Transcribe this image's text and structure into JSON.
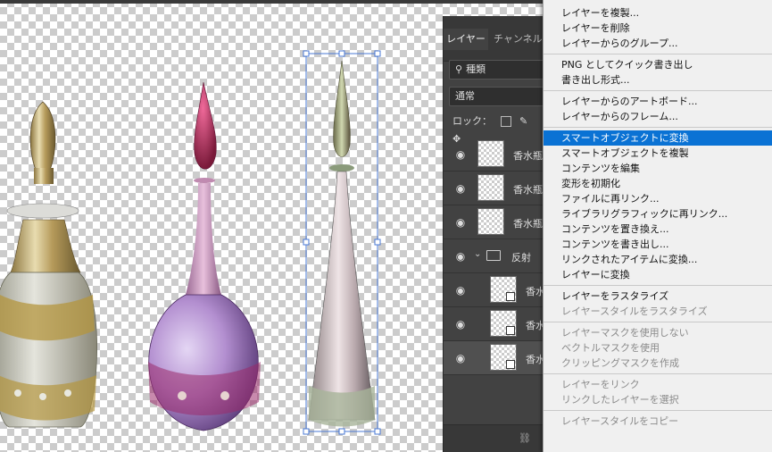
{
  "layers_panel": {
    "tabs": [
      {
        "label": "レイヤー",
        "active": true
      },
      {
        "label": "チャンネル",
        "active": false
      }
    ],
    "search_value": "種類",
    "blend_mode": "通常",
    "lock_label": "ロック：",
    "layers": [
      {
        "name": "香水瓶",
        "type": "smart-object",
        "indent": false
      },
      {
        "name": "香水瓶",
        "type": "smart-object",
        "indent": false
      },
      {
        "name": "香水瓶",
        "type": "smart-object",
        "indent": false
      },
      {
        "name": "反射",
        "type": "group",
        "indent": false
      },
      {
        "name": "香水",
        "type": "smart-object",
        "indent": true
      },
      {
        "name": "香水",
        "type": "smart-object",
        "indent": true
      },
      {
        "name": "香水",
        "type": "smart-object",
        "indent": true,
        "selected": true
      }
    ]
  },
  "context_menu": {
    "items": [
      {
        "label": "レイヤーを複製...",
        "enabled": true
      },
      {
        "label": "レイヤーを削除",
        "enabled": true
      },
      {
        "label": "レイヤーからのグループ...",
        "enabled": true
      },
      {
        "separator": true
      },
      {
        "label": "PNG としてクイック書き出し",
        "enabled": true
      },
      {
        "label": "書き出し形式...",
        "enabled": true
      },
      {
        "separator": true
      },
      {
        "label": "レイヤーからのアートボード...",
        "enabled": true
      },
      {
        "label": "レイヤーからのフレーム...",
        "enabled": true
      },
      {
        "separator": true
      },
      {
        "label": "スマートオブジェクトに変換",
        "enabled": true,
        "highlighted": true
      },
      {
        "label": "スマートオブジェクトを複製",
        "enabled": true
      },
      {
        "label": "コンテンツを編集",
        "enabled": true
      },
      {
        "label": "変形を初期化",
        "enabled": true
      },
      {
        "label": "ファイルに再リンク...",
        "enabled": true
      },
      {
        "label": "ライブラリグラフィックに再リンク...",
        "enabled": true
      },
      {
        "label": "コンテンツを置き換え...",
        "enabled": true
      },
      {
        "label": "コンテンツを書き出し...",
        "enabled": true
      },
      {
        "label": "リンクされたアイテムに変換...",
        "enabled": true
      },
      {
        "label": "レイヤーに変換",
        "enabled": true
      },
      {
        "separator": true
      },
      {
        "label": "レイヤーをラスタライズ",
        "enabled": true
      },
      {
        "label": "レイヤースタイルをラスタライズ",
        "enabled": false
      },
      {
        "separator": true
      },
      {
        "label": "レイヤーマスクを使用しない",
        "enabled": false
      },
      {
        "label": "ベクトルマスクを使用",
        "enabled": false
      },
      {
        "label": "クリッピングマスクを作成",
        "enabled": false
      },
      {
        "separator": true
      },
      {
        "label": "レイヤーをリンク",
        "enabled": false
      },
      {
        "label": "リンクしたレイヤーを選択",
        "enabled": false
      },
      {
        "separator": true
      },
      {
        "label": "レイヤースタイルをコピー",
        "enabled": false
      }
    ],
    "highlight_color": "#0a72d4"
  }
}
